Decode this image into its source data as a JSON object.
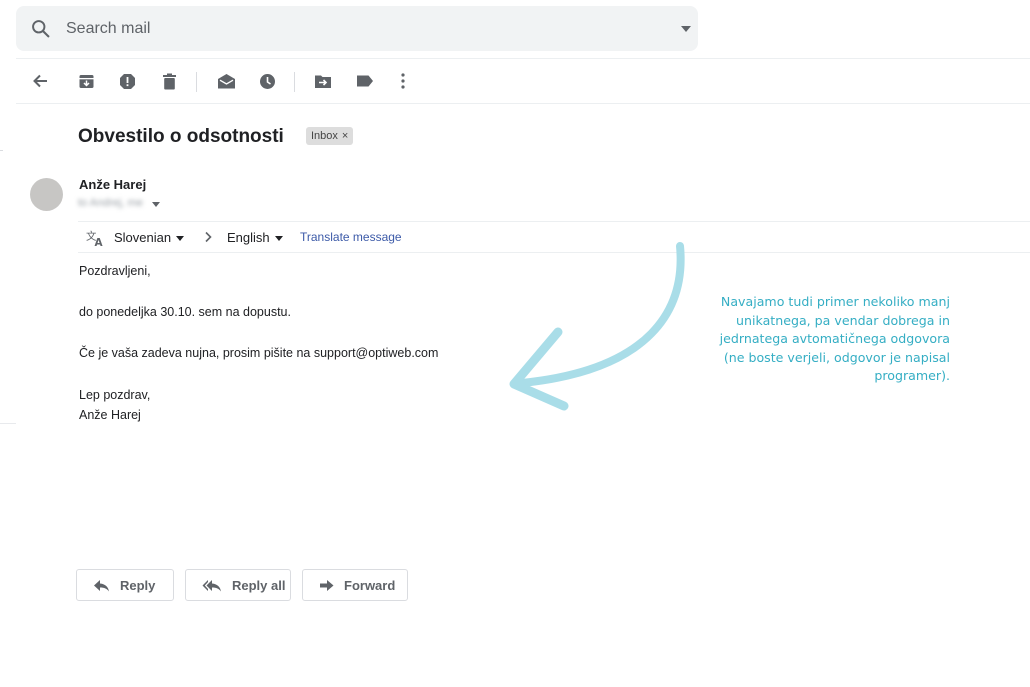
{
  "search": {
    "placeholder": "Search mail"
  },
  "toolbar": {
    "icons": [
      "back-arrow-icon",
      "archive-icon",
      "report-spam-icon",
      "delete-icon",
      "mark-unread-icon",
      "snooze-icon",
      "move-to-icon",
      "label-icon",
      "more-options-icon"
    ]
  },
  "email": {
    "subject": "Obvestilo o odsotnosti",
    "label": "Inbox",
    "label_close": "×",
    "sender": "Anže Harej",
    "recipient_blurred": "to Andrej, me"
  },
  "translate": {
    "from": "Slovenian",
    "to": "English",
    "link": "Translate message"
  },
  "body": {
    "greeting": "Pozdravljeni,",
    "line1": "do ponedeljka 30.10. sem na dopustu.",
    "line2": "Če je vaša zadeva nujna, prosim pišite na support@optiweb.com",
    "closing": "Lep pozdrav,",
    "signature": "Anže Harej"
  },
  "actions": {
    "reply": "Reply",
    "reply_all": "Reply all",
    "forward": "Forward"
  },
  "annotation": {
    "lines": [
      "Navajamo tudi primer nekoliko manj",
      "unikatnega, pa vendar dobrega in",
      "jedrnatega avtomatičnega odgovora",
      "(ne boste verjeli, odgovor je napisal",
      "programer)."
    ]
  },
  "colors": {
    "annotation": "#35aec4",
    "arrow": "#a9dde8",
    "link": "#3c5aa8",
    "icon": "#5f6368"
  }
}
